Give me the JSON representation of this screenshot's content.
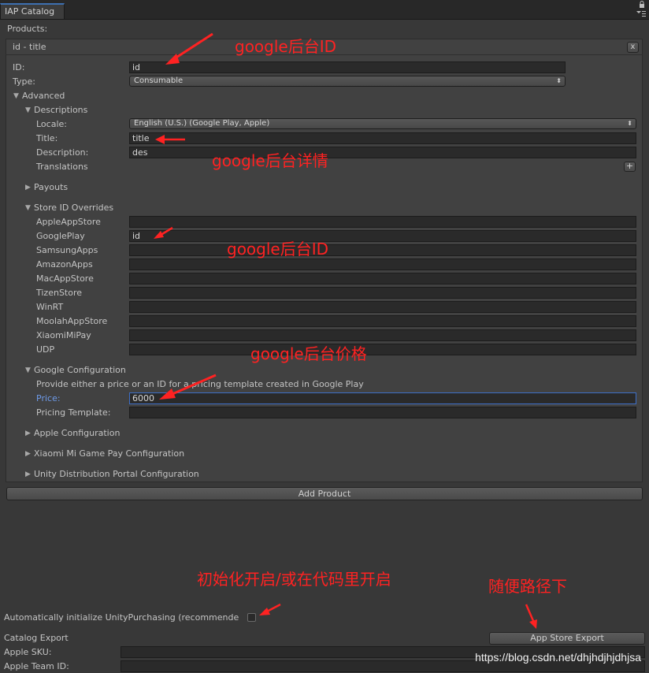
{
  "window": {
    "tab_title": "IAP Catalog"
  },
  "products_label": "Products:",
  "product": {
    "header": "id - title",
    "remove_label": "x",
    "id_label": "ID:",
    "id_value": "id",
    "type_label": "Type:",
    "type_value": "Consumable",
    "advanced_label": "Advanced",
    "descriptions_label": "Descriptions",
    "locale_label": "Locale:",
    "locale_value": "English (U.S.) (Google Play, Apple)",
    "title_label": "Title:",
    "title_value": "title",
    "description_label": "Description:",
    "description_value": "des",
    "translations_label": "Translations",
    "translations_add": "+",
    "payouts_label": "Payouts",
    "store_overrides_label": "Store ID Overrides",
    "stores": [
      {
        "name": "AppleAppStore",
        "value": ""
      },
      {
        "name": "GooglePlay",
        "value": "id"
      },
      {
        "name": "SamsungApps",
        "value": ""
      },
      {
        "name": "AmazonApps",
        "value": ""
      },
      {
        "name": "MacAppStore",
        "value": ""
      },
      {
        "name": "TizenStore",
        "value": ""
      },
      {
        "name": "WinRT",
        "value": ""
      },
      {
        "name": "MoolahAppStore",
        "value": ""
      },
      {
        "name": "XiaomiMiPay",
        "value": ""
      },
      {
        "name": "UDP",
        "value": ""
      }
    ],
    "google_config_label": "Google Configuration",
    "google_hint": "Provide either a price or an ID for a pricing template created in Google Play",
    "price_label": "Price:",
    "price_value": "6000",
    "pricing_template_label": "Pricing Template:",
    "pricing_template_value": "",
    "apple_config_label": "Apple Configuration",
    "xiaomi_config_label": "Xiaomi Mi Game Pay Configuration",
    "udp_config_label": "Unity Distribution Portal Configuration"
  },
  "add_product_label": "Add Product",
  "auto_init_label": "Automatically initialize UnityPurchasing (recommende",
  "catalog_export_label": "Catalog Export",
  "app_store_export_label": "App Store Export",
  "apple_sku_label": "Apple SKU:",
  "apple_team_id_label": "Apple Team ID:",
  "annotations": {
    "id_note": "google后台ID",
    "detail_note": "google后台详情",
    "store_id_note": "google后台ID",
    "price_note": "google后台价格",
    "init_note": "初始化开启/或在代码里开启",
    "export_note": "随便路径下"
  },
  "watermark": "https://blog.csdn.net/dhjhdjhjdhjsa",
  "colors": {
    "annotation": "#ff2222",
    "focus_border": "#3d6fc8",
    "price_label": "#6e9bea"
  }
}
